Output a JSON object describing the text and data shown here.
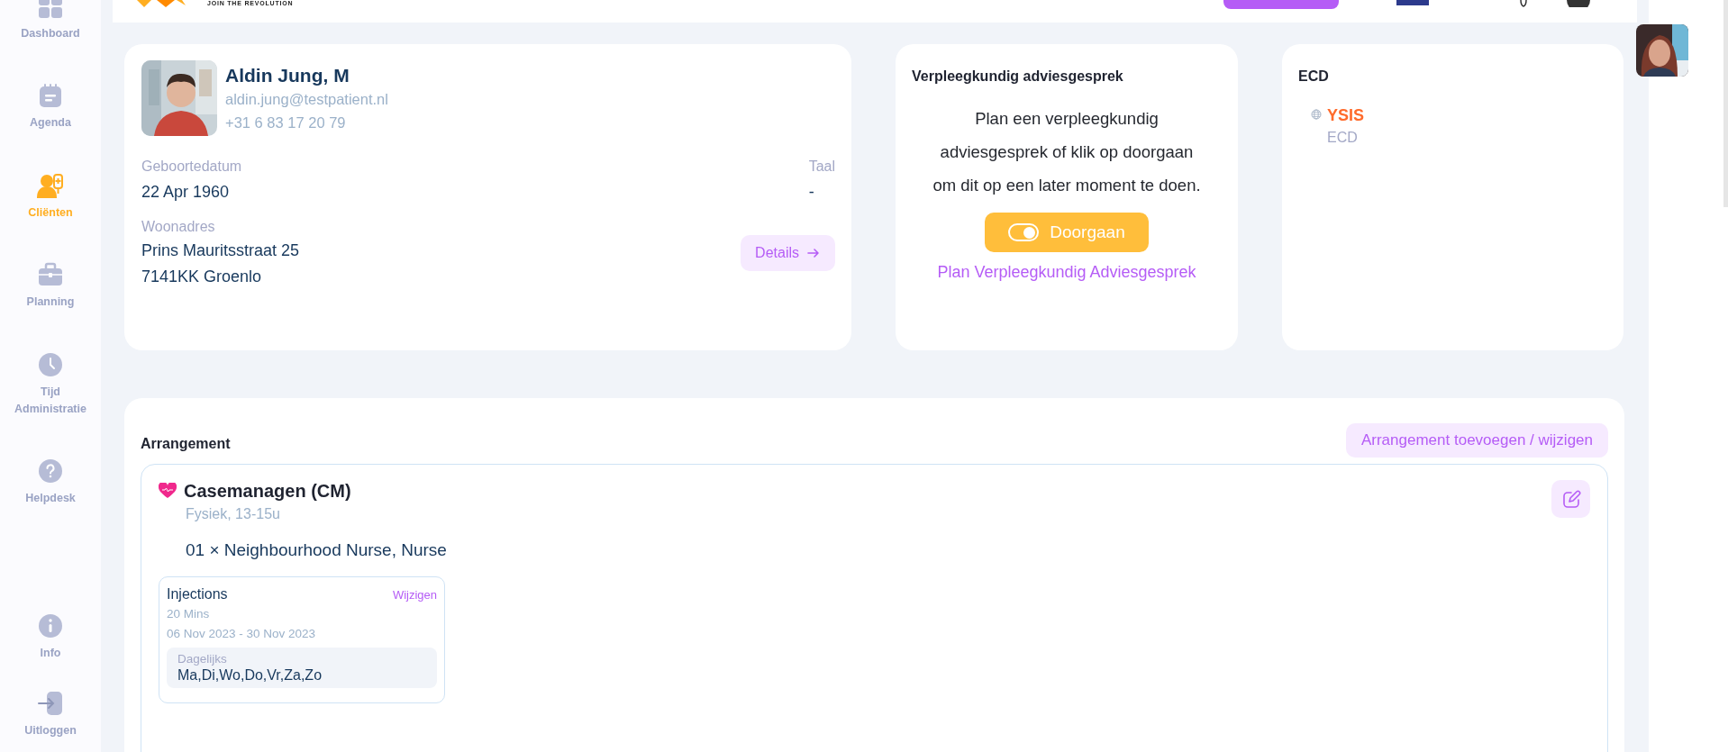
{
  "header": {
    "tagline": "JOIN THE REVOLUTION"
  },
  "sidebar": {
    "items": [
      {
        "label": "Dashboard",
        "kind": "dashboard",
        "selected": false
      },
      {
        "label": "Agenda",
        "kind": "agenda",
        "selected": false
      },
      {
        "label": "Cliënten",
        "kind": "clients",
        "selected": true
      },
      {
        "label": "Planning",
        "kind": "planning",
        "selected": false
      },
      {
        "label": "Tijd Administratie",
        "kind": "time",
        "selected": false
      },
      {
        "label": "Helpdesk",
        "kind": "help",
        "selected": false
      }
    ],
    "bottom_items": [
      {
        "label": "Info",
        "kind": "info",
        "selected": false
      },
      {
        "label": "Uitloggen",
        "kind": "logout",
        "selected": false
      }
    ]
  },
  "client": {
    "name": "Aldin Jung, M",
    "email": "aldin.jung@testpatient.nl",
    "phone": "+31 6 83 17 20 79",
    "birth": {
      "label": "Geboortedatum",
      "value": "22 Apr 1960"
    },
    "language": {
      "label": "Taal",
      "value": "-"
    },
    "address": {
      "label": "Woonadres",
      "lines": [
        "Prins Mauritsstraat 25",
        "7141KK Groenlo"
      ]
    },
    "details_button": "Details"
  },
  "advice": {
    "title": "Verpleegkundig adviesgesprek",
    "text": "Plan een verpleegkundig adviesgesprek of klik op doorgaan om dit op een later moment te doen.",
    "continue_button": {
      "label": "Doorgaan",
      "on": true
    },
    "plan_link": "Plan Verpleegkundig Adviesgesprek"
  },
  "ecd": {
    "title": "ECD",
    "system": {
      "name": "YSIS",
      "type": "ECD"
    }
  },
  "arrangement": {
    "title": "Arrangement",
    "add_button": "Arrangement toevoegen / wijzigen",
    "services": [
      {
        "name": "Casemanagen (CM)",
        "subtitle": "Fysiek, 13-15u",
        "staff": "01 × Neighbourhood Nurse, Nurse",
        "tasks": [
          {
            "name": "Injections",
            "edit_link": "Wijzigen",
            "duration": "20 Mins",
            "period": "06 Nov 2023 - 30 Nov 2023",
            "frequency": "Dagelijks",
            "days": "Ma,Di,Wo,Do,Vr,Za,Zo"
          }
        ]
      }
    ]
  }
}
